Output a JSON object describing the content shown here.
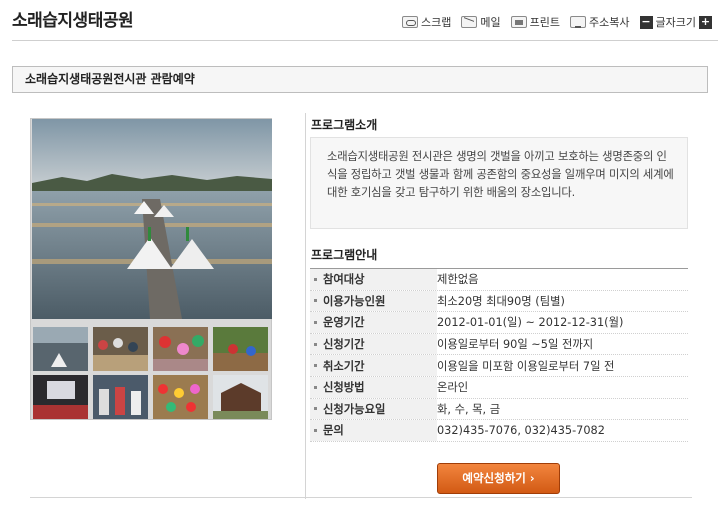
{
  "page": {
    "title": "소래습지생태공원"
  },
  "toolbar": {
    "scrap": "스크랩",
    "mail": "메일",
    "print": "프린트",
    "copy_address": "주소복사",
    "font_size": "글자크기",
    "font_minus": "−",
    "font_plus": "+"
  },
  "section": {
    "title": "소래습지생태공원전시관 관람예약"
  },
  "intro": {
    "heading": "프로그램소개",
    "text": "소래습지생태공원 전시관은 생명의 갯벌을 아끼고 보호하는 생명존중의 인식을 정립하고 갯벌 생물과 함께 공존함의 중요성을 일깨우며 미지의 세계에 대한 호기심을 갖고 탐구하기 위한 배움의 장소입니다."
  },
  "guide": {
    "heading": "프로그램안내",
    "rows": [
      {
        "label": "참여대상",
        "value": "제한없음"
      },
      {
        "label": "이용가능인원",
        "value": "최소20명 최대90명 (팀별)"
      },
      {
        "label": "운영기간",
        "value": "2012-01-01(일) ~ 2012-12-31(월)"
      },
      {
        "label": "신청기간",
        "value": "이용일로부터 90일 ~5일 전까지"
      },
      {
        "label": "취소기간",
        "value": "이용일을 미포함 이용일로부터 7일 전"
      },
      {
        "label": "신청방법",
        "value": "온라인"
      },
      {
        "label": "신청가능요일",
        "value": "화, 수, 목, 금"
      },
      {
        "label": "문의",
        "value": "032)435-7076, 032)435-7082"
      }
    ]
  },
  "button": {
    "reserve": "예약신청하기 ›"
  },
  "colors": {
    "button_top": "#f2853e",
    "button_bottom": "#d25a14",
    "label_bg": "#f1f1f1"
  }
}
